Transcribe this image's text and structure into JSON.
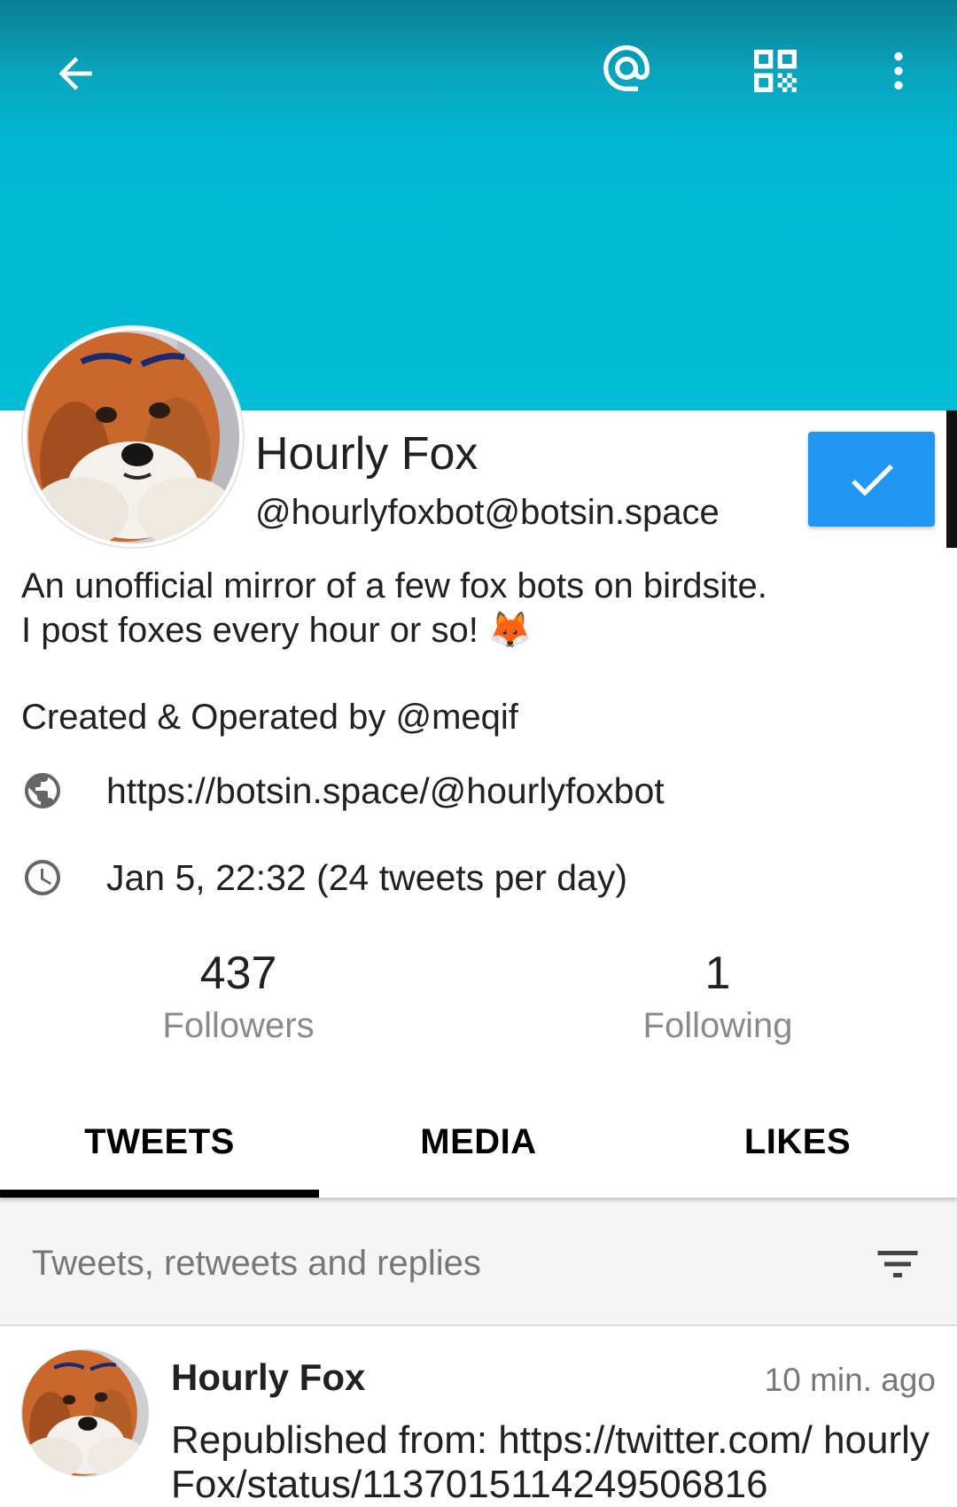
{
  "colors": {
    "banner": "#00bcd4",
    "follow_button": "#2196f3",
    "tab_indicator": "#000000"
  },
  "toolbar": {
    "back_icon": "arrow-left-icon",
    "mention_icon": "at-sign-icon",
    "qr_icon": "qr-code-icon",
    "more_icon": "more-vertical-icon"
  },
  "profile": {
    "display_name": "Hourly Fox",
    "handle": "@hourlyfoxbot@botsin.space",
    "follow_state_icon": "check-icon",
    "bio_line1": "An unofficial mirror of a few fox bots on birdsite.",
    "bio_line2": "I post foxes every hour or so! 🦊",
    "bio_line3": "Created & Operated by @meqif",
    "url": "https://botsin.space/@hourlyfoxbot",
    "created": "Jan 5, 22:32 (24 tweets per day)"
  },
  "stats": {
    "followers_count": "437",
    "followers_label": "Followers",
    "following_count": "1",
    "following_label": "Following"
  },
  "tabs": [
    {
      "label": "TWEETS",
      "active": true
    },
    {
      "label": "MEDIA",
      "active": false
    },
    {
      "label": "LIKES",
      "active": false
    }
  ],
  "filter": {
    "label": "Tweets, retweets and replies",
    "icon": "filter-icon"
  },
  "tweet": {
    "author": "Hourly Fox",
    "time": "10 min. ago",
    "text": "Republished from: https://twitter.com/ hourlyFox/status/1137015114249506816"
  }
}
